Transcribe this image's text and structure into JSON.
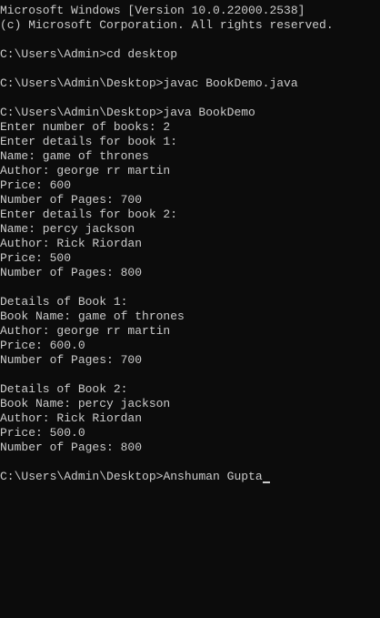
{
  "console": {
    "lines": [
      "Microsoft Windows [Version 10.0.22000.2538]",
      "(c) Microsoft Corporation. All rights reserved.",
      "",
      "C:\\Users\\Admin>cd desktop",
      "",
      "C:\\Users\\Admin\\Desktop>javac BookDemo.java",
      "",
      "C:\\Users\\Admin\\Desktop>java BookDemo",
      "Enter number of books: 2",
      "Enter details for book 1:",
      "Name: game of thrones",
      "Author: george rr martin",
      "Price: 600",
      "Number of Pages: 700",
      "Enter details for book 2:",
      "Name: percy jackson",
      "Author: Rick Riordan",
      "Price: 500",
      "Number of Pages: 800",
      "",
      "Details of Book 1:",
      "Book Name: game of thrones",
      "Author: george rr martin",
      "Price: 600.0",
      "Number of Pages: 700",
      "",
      "Details of Book 2:",
      "Book Name: percy jackson",
      "Author: Rick Riordan",
      "Price: 500.0",
      "Number of Pages: 800",
      ""
    ],
    "current_prompt": "C:\\Users\\Admin\\Desktop>",
    "current_input": "Anshuman Gupta"
  },
  "colors": {
    "background": "#0c0c0c",
    "text": "#cccccc"
  }
}
